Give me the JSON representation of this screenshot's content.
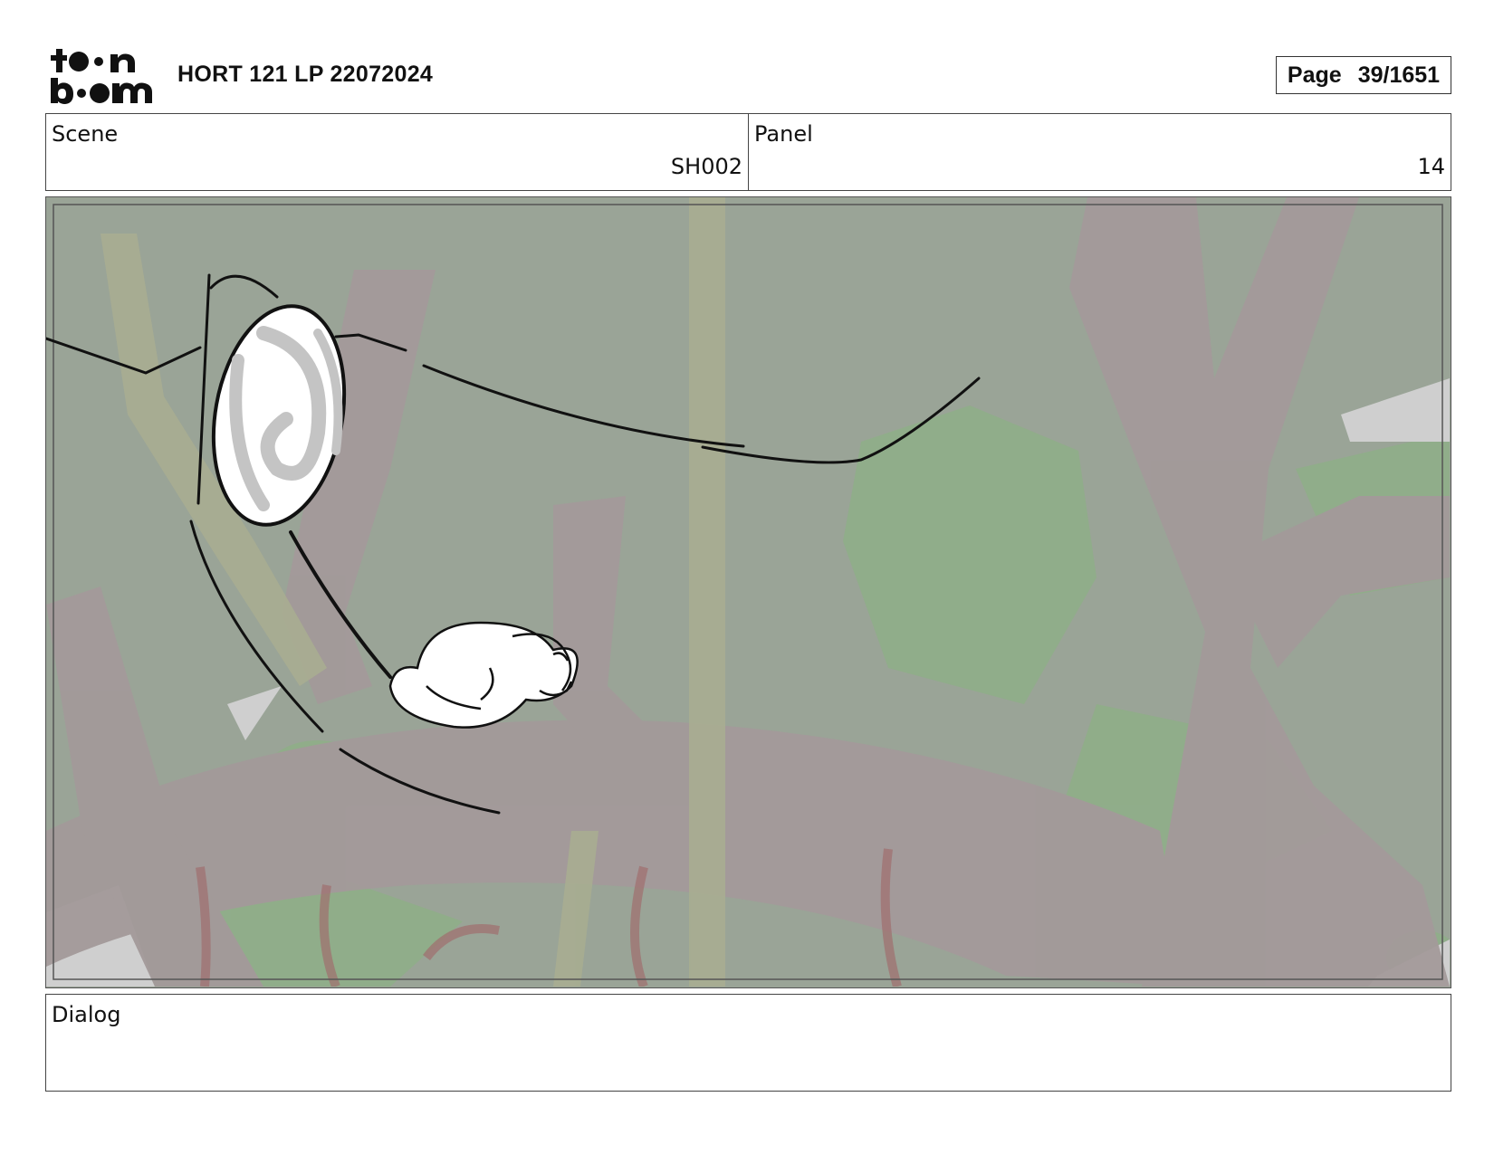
{
  "header": {
    "logo_name": "toonboom-logo",
    "title": "HORT 121 LP 22072024",
    "page_label": "Page",
    "page_number": "39/1651"
  },
  "info": {
    "scene_label": "Scene",
    "scene_value": "SH002",
    "panel_label": "Panel",
    "panel_value": "14"
  },
  "panel": {
    "background_color": "#9aa497",
    "branch_color": "#a39a9a",
    "leaf_color": "#8fb08a",
    "line_color": "#111111"
  },
  "dialog": {
    "label": "Dialog",
    "text": ""
  }
}
